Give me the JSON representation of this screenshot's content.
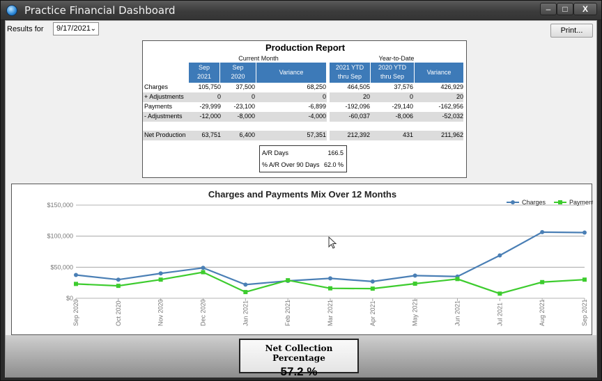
{
  "window": {
    "title": "Practice Financial Dashboard",
    "controls": {
      "minimize": "–",
      "maximize": "□",
      "close": "X"
    }
  },
  "toolbar": {
    "results_label": "Results for",
    "date_value": "9/17/2021",
    "print_label": "Print..."
  },
  "report": {
    "title": "Production Report",
    "current_month_label": "Current Month",
    "ytd_label": "Year-to-Date",
    "headers": {
      "sep2021": [
        "Sep",
        "2021"
      ],
      "sep2020": [
        "Sep",
        "2020"
      ],
      "variance1": "Variance",
      "ytd2021": [
        "2021 YTD",
        "thru Sep"
      ],
      "ytd2020": [
        "2020 YTD",
        "thru Sep"
      ],
      "variance2": "Variance"
    },
    "rows": [
      {
        "label": "Charges",
        "values": [
          "105,750",
          "37,500",
          "68,250",
          "464,505",
          "37,576",
          "426,929"
        ]
      },
      {
        "label": "+ Adjustments",
        "values": [
          "0",
          "0",
          "0",
          "20",
          "0",
          "20"
        ]
      },
      {
        "label": "Payments",
        "values": [
          "-29,999",
          "-23,100",
          "-6,899",
          "-192,096",
          "-29,140",
          "-162,956"
        ]
      },
      {
        "label": "- Adjustments",
        "values": [
          "-12,000",
          "-8,000",
          "-4,000",
          "-60,037",
          "-8,006",
          "-52,032"
        ]
      }
    ],
    "net": {
      "label": "Net Production",
      "values": [
        "63,751",
        "6,400",
        "57,351",
        "212,392",
        "431",
        "211,962"
      ]
    },
    "ar": {
      "days_label": "A/R Days",
      "days_value": "166.5",
      "over90_label": "% A/R Over 90 Days",
      "over90_value": "62.0 %"
    }
  },
  "chart_data": {
    "type": "line",
    "title": "Charges and Payments Mix Over 12 Months",
    "categories": [
      "Sep 2020",
      "Oct 2020",
      "Nov 2020",
      "Dec 2020",
      "Jan 2021",
      "Feb 2021",
      "Mar 2021",
      "Apr 2021",
      "May 2021",
      "Jun 2021",
      "Jul 2021",
      "Aug 2021",
      "Sep 2021"
    ],
    "series": [
      {
        "name": "Charges",
        "color": "#4a7fb5",
        "values": [
          37500,
          30000,
          40000,
          49000,
          22000,
          28000,
          32000,
          27000,
          36500,
          35000,
          69000,
          106500,
          105750
        ]
      },
      {
        "name": "Payments",
        "color": "#3dcc2e",
        "values": [
          23100,
          20000,
          30000,
          42000,
          10000,
          29000,
          16000,
          15500,
          23500,
          31000,
          7500,
          26000,
          29999
        ]
      }
    ],
    "yticks": [
      "$0",
      "$50,000",
      "$100,000",
      "$150,000"
    ],
    "ylim": [
      0,
      150000
    ],
    "grid": "horizontal",
    "legend": "top-right"
  },
  "summary": {
    "title": "Net Collection Percentage",
    "value": "57.2 %"
  }
}
